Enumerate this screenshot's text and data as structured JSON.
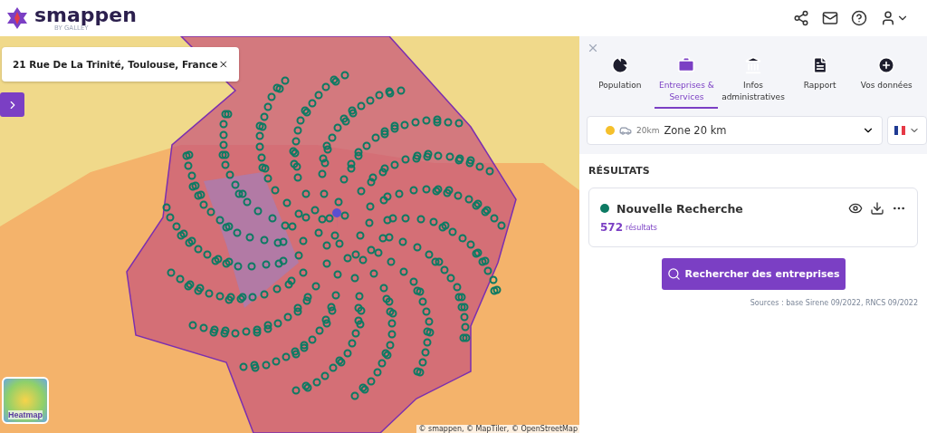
{
  "header": {
    "brand": "smappen",
    "brand_sub": "BY GALLEY"
  },
  "map": {
    "address": "21 Rue De La Trinité, Toulouse, France",
    "heatmap_label": "Heatmap",
    "attribution": "© smappen, © MapTiler, © OpenStreetMap"
  },
  "panel": {
    "tabs": [
      {
        "label": "Population",
        "selected": false
      },
      {
        "label": "Entreprises & Services",
        "selected": true
      },
      {
        "label": "Infos administratives",
        "selected": false
      },
      {
        "label": "Rapport",
        "selected": false
      },
      {
        "label": "Vos données",
        "selected": false
      }
    ],
    "zone": {
      "color": "#f5c02c",
      "distance": "20km",
      "name": "Zone 20 km"
    },
    "results_title": "RÉSULTATS",
    "result": {
      "color": "#0d7a63",
      "name": "Nouvelle Recherche",
      "count": "572",
      "count_label": "résultats"
    },
    "search_button": "Rechercher des entreprises",
    "sources": "Sources : base Sirene 09/2022, RNCS 09/2022"
  }
}
